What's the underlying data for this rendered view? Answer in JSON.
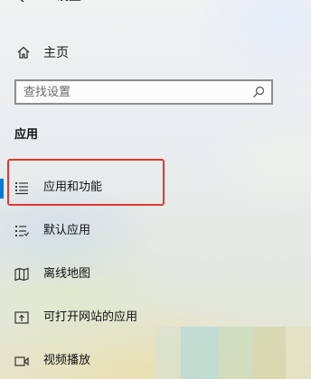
{
  "header": {
    "title": "设置"
  },
  "home": {
    "label": "主页"
  },
  "search": {
    "placeholder": "查找设置"
  },
  "section": {
    "title": "应用"
  },
  "nav": {
    "items": [
      {
        "label": "应用和功能"
      },
      {
        "label": "默认应用"
      },
      {
        "label": "离线地图"
      },
      {
        "label": "可打开网站的应用"
      },
      {
        "label": "视频播放"
      }
    ]
  },
  "colors": {
    "accent": "#0078d7",
    "highlight_border": "#e4362e"
  },
  "icons": [
    "back-arrow-icon",
    "home-icon",
    "search-icon",
    "apps-features-icon",
    "default-apps-icon",
    "offline-maps-icon",
    "apps-for-websites-icon",
    "video-playback-icon"
  ]
}
